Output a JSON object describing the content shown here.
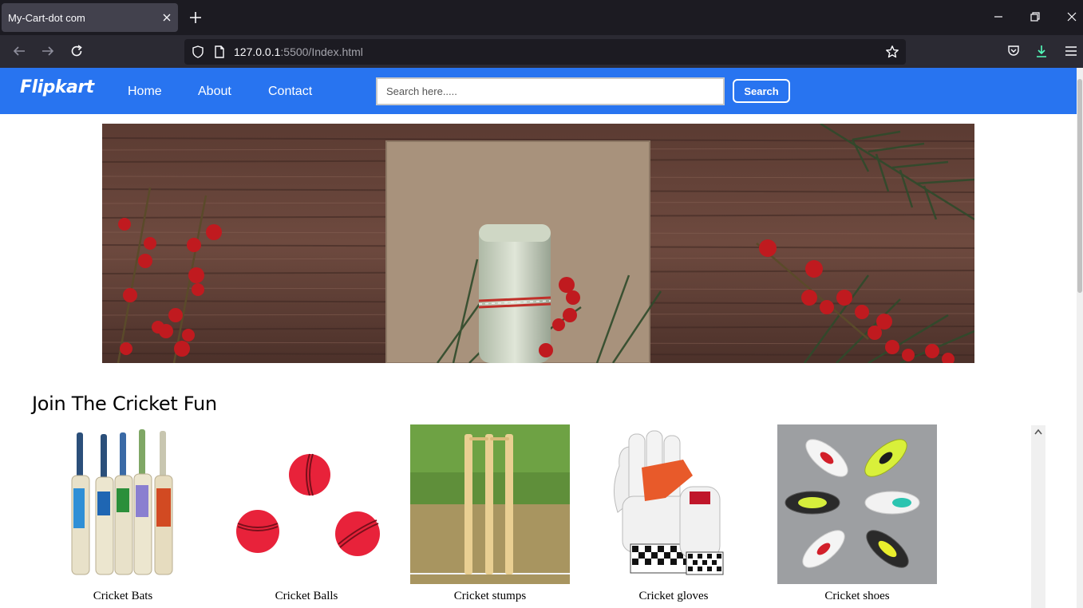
{
  "browser": {
    "tab_title": "My-Cart-dot com",
    "url_host": "127.0.0.1",
    "url_rest": ":5500/Index.html"
  },
  "site": {
    "logo": "Flipkart",
    "nav": [
      "Home",
      "About",
      "Contact"
    ],
    "search_placeholder": "Search here.....",
    "search_button": "Search",
    "brand_color": "#2874f0"
  },
  "section": {
    "title": "Join The Cricket Fun"
  },
  "products": [
    {
      "name": "Cricket Bats"
    },
    {
      "name": "Cricket Balls"
    },
    {
      "name": "Cricket stumps"
    },
    {
      "name": "Cricket gloves"
    },
    {
      "name": "Cricket shoes"
    }
  ]
}
